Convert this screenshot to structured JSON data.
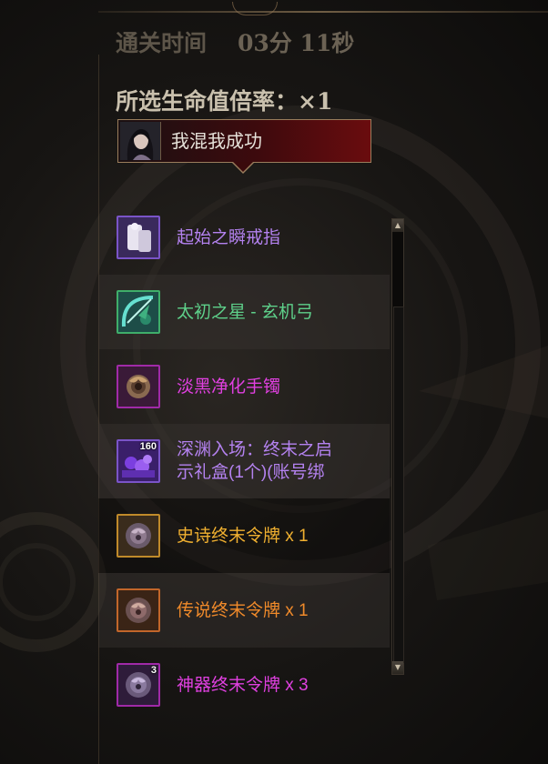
{
  "clear_time": {
    "label": "通关时间",
    "value": "03分 11秒"
  },
  "hp_multiplier": {
    "label": "所选生命值倍率：×1"
  },
  "player": {
    "name": "我混我成功",
    "avatar_icon": "character-portrait-icon"
  },
  "rewards": [
    {
      "name": "起始之瞬戒指",
      "color": "#b482f0",
      "icon": "scroll-item-icon",
      "icon_border": "#7a54c8",
      "badge": ""
    },
    {
      "name": "太初之星 - 玄机弓",
      "color": "#5ed08a",
      "icon": "bow-item-icon",
      "icon_border": "#3fae6a",
      "badge": ""
    },
    {
      "name": "淡黑净化手镯",
      "color": "#e040e0",
      "icon": "bracelet-item-icon",
      "icon_border": "#a02aa8",
      "badge": ""
    },
    {
      "name": "深渊入场：终末之启\n示礼盒(1个)(账号绑",
      "color": "#b482f0",
      "icon": "gift-box-item-icon",
      "icon_border": "#7a54c8",
      "badge": "160"
    },
    {
      "name": "史诗终末令牌 x 1",
      "color": "#f0b030",
      "icon": "epic-token-icon",
      "icon_border": "#c08a2a",
      "badge": ""
    },
    {
      "name": "传说终末令牌 x 1",
      "color": "#f08a2a",
      "icon": "legendary-token-icon",
      "icon_border": "#c2662a",
      "badge": ""
    },
    {
      "name": "神器终末令牌 x 3",
      "color": "#e040e0",
      "icon": "artifact-token-icon",
      "icon_border": "#a02aa8",
      "badge": "3"
    }
  ],
  "scrollbar": {
    "up_icon": "scroll-up-icon",
    "down_icon": "scroll-down-icon"
  }
}
